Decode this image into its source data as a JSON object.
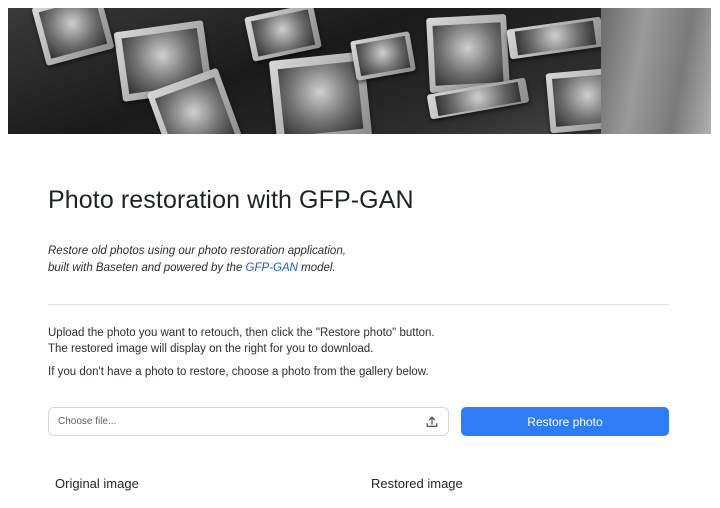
{
  "hero": {
    "image_description_icon": "vintage-photo-frames-image"
  },
  "header": {
    "title": "Photo restoration with GFP-GAN"
  },
  "intro": {
    "line1": "Restore old photos using our photo restoration application,",
    "line2_before": "built with Baseten and powered by the ",
    "link_text": "GFP-GAN",
    "line2_after": " model."
  },
  "instructions": {
    "line1": "Upload the photo you want to retouch, then click the \"Restore photo\" button.",
    "line2": "The restored image will display on the right for you to download.",
    "gallery_note": "If you don't have a photo to restore, choose a photo from the gallery below."
  },
  "upload": {
    "placeholder": "Choose file...",
    "icon": "upload-icon"
  },
  "actions": {
    "restore_label": "Restore photo"
  },
  "columns": {
    "original_label": "Original image",
    "restored_label": "Restored image"
  },
  "colors": {
    "accent": "#2e7cf6",
    "link": "#1f5fbf",
    "text": "#1f2329"
  }
}
